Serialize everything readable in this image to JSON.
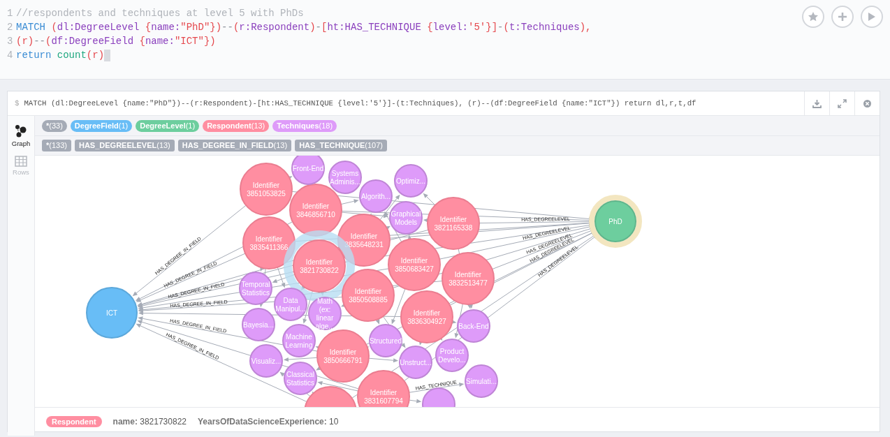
{
  "editor": {
    "lines": [
      {
        "number": "1",
        "tokens": [
          {
            "kind": "comment",
            "text": "//respondents and techniques at level 5 with PhDs"
          }
        ]
      },
      {
        "number": "2",
        "tokens": [
          {
            "kind": "keyword",
            "text": "MATCH "
          },
          {
            "kind": "punct",
            "text": "("
          },
          {
            "kind": "ident",
            "text": "dl:DegreeLevel "
          },
          {
            "kind": "punct",
            "text": "{"
          },
          {
            "kind": "ident",
            "text": "name:"
          },
          {
            "kind": "string",
            "text": "\"PhD\""
          },
          {
            "kind": "punct",
            "text": "})"
          },
          {
            "kind": "op",
            "text": "--"
          },
          {
            "kind": "punct",
            "text": "("
          },
          {
            "kind": "ident",
            "text": "r:Respondent"
          },
          {
            "kind": "punct",
            "text": ")"
          },
          {
            "kind": "op",
            "text": "-"
          },
          {
            "kind": "punct",
            "text": "["
          },
          {
            "kind": "ident",
            "text": "ht:HAS_TECHNIQUE "
          },
          {
            "kind": "punct",
            "text": "{"
          },
          {
            "kind": "ident",
            "text": "level:"
          },
          {
            "kind": "string",
            "text": "'5'"
          },
          {
            "kind": "punct",
            "text": "}]"
          },
          {
            "kind": "op",
            "text": "-"
          },
          {
            "kind": "punct",
            "text": "("
          },
          {
            "kind": "ident",
            "text": "t:Techniques"
          },
          {
            "kind": "punct",
            "text": "),"
          }
        ]
      },
      {
        "number": "3",
        "tokens": [
          {
            "kind": "punct",
            "text": "(r)"
          },
          {
            "kind": "op",
            "text": "--"
          },
          {
            "kind": "punct",
            "text": "("
          },
          {
            "kind": "ident",
            "text": "df:DegreeField "
          },
          {
            "kind": "punct",
            "text": "{"
          },
          {
            "kind": "ident",
            "text": "name:"
          },
          {
            "kind": "string",
            "text": "\"ICT\""
          },
          {
            "kind": "punct",
            "text": "})"
          }
        ]
      },
      {
        "number": "4",
        "tokens": [
          {
            "kind": "keyword",
            "text": "return "
          },
          {
            "kind": "func",
            "text": "count"
          },
          {
            "kind": "punct",
            "text": "(r)"
          }
        ]
      }
    ]
  },
  "frame": {
    "prompt": "$",
    "query": "MATCH (dl:DegreeLevel {name:\"PhD\"})--(r:Respondent)-[ht:HAS_TECHNIQUE {level:'5'}]-(t:Techniques), (r)--(df:DegreeField {name:\"ICT\"}) return dl,r,t,df"
  },
  "sidebar": [
    {
      "label": "Graph",
      "kind": "graph",
      "selected": true
    },
    {
      "label": "Rows",
      "kind": "rows",
      "selected": false
    }
  ],
  "node_labels": [
    {
      "name": "*",
      "count": "(33)",
      "color": "#a5abb6"
    },
    {
      "name": "DegreeField",
      "count": "(1)",
      "color": "#68bdf6"
    },
    {
      "name": "DegreeLevel",
      "count": "(1)",
      "color": "#6dce9e"
    },
    {
      "name": "Respondent",
      "count": "(13)",
      "color": "#ff8ea1"
    },
    {
      "name": "Techniques",
      "count": "(18)",
      "color": "#de9bf9"
    }
  ],
  "relationship_types": [
    {
      "name": "*",
      "count": "(133)"
    },
    {
      "name": "HAS_DEGREELEVEL",
      "count": "(13)"
    },
    {
      "name": "HAS_DEGREE_IN_FIELD",
      "count": "(13)"
    },
    {
      "name": "HAS_TECHNIQUE",
      "count": "(107)"
    }
  ],
  "graph": {
    "nodes": [
      {
        "kind": "field",
        "lines": [
          "ICT"
        ],
        "selected": false,
        "hovered": false
      },
      {
        "kind": "level",
        "lines": [
          "PhD"
        ],
        "selected": false,
        "hovered": true
      },
      {
        "kind": "respondent",
        "lines": [
          "Identifier",
          "3851053825"
        ],
        "selected": false,
        "hovered": false
      },
      {
        "kind": "respondent",
        "lines": [
          "Identifier",
          "3846856710"
        ],
        "selected": false,
        "hovered": false
      },
      {
        "kind": "respondent",
        "lines": [
          "Identifier",
          "3835411366"
        ],
        "selected": false,
        "hovered": false
      },
      {
        "kind": "respondent",
        "lines": [
          "Identifier",
          "3835648231"
        ],
        "selected": false,
        "hovered": false
      },
      {
        "kind": "respondent",
        "lines": [
          "Identifier",
          "3821730822"
        ],
        "selected": true,
        "hovered": false
      },
      {
        "kind": "respondent",
        "lines": [
          "Identifier",
          "3821165338"
        ],
        "selected": false,
        "hovered": false
      },
      {
        "kind": "respondent",
        "lines": [
          "Identifier",
          "3850683427"
        ],
        "selected": false,
        "hovered": false
      },
      {
        "kind": "respondent",
        "lines": [
          "Identifier",
          "3832513477"
        ],
        "selected": false,
        "hovered": false
      },
      {
        "kind": "respondent",
        "lines": [
          "Identifier",
          "3850508885"
        ],
        "selected": false,
        "hovered": false
      },
      {
        "kind": "respondent",
        "lines": [
          "Identifier",
          "3836304927"
        ],
        "selected": false,
        "hovered": false
      },
      {
        "kind": "respondent",
        "lines": [
          "Identifier",
          "3850666791"
        ],
        "selected": false,
        "hovered": false
      },
      {
        "kind": "respondent",
        "lines": [
          "Identifier",
          "3831607794"
        ],
        "selected": false,
        "hovered": false
      },
      {
        "kind": "respondent",
        "selected": false,
        "hovered": false
      },
      {
        "kind": "technique",
        "lines": [
          "Front-End"
        ],
        "selected": false,
        "hovered": false
      },
      {
        "kind": "technique",
        "lines": [
          "Systems",
          "Adminis..."
        ],
        "selected": false,
        "hovered": false
      },
      {
        "kind": "technique",
        "lines": [
          "Algorith..."
        ],
        "selected": false,
        "hovered": false
      },
      {
        "kind": "technique",
        "lines": [
          "Optimiz..."
        ],
        "selected": false,
        "hovered": false
      },
      {
        "kind": "technique",
        "lines": [
          "Graphical",
          "Models"
        ],
        "selected": false,
        "hovered": false
      },
      {
        "kind": "technique",
        "lines": [
          "Temporal",
          "Statistics"
        ],
        "selected": false,
        "hovered": false
      },
      {
        "kind": "technique",
        "lines": [
          "Data",
          "Manipul..."
        ],
        "selected": false,
        "hovered": false
      },
      {
        "kind": "technique",
        "lines": [
          "Bayesia..."
        ],
        "selected": false,
        "hovered": false
      },
      {
        "kind": "technique",
        "lines": [
          "Math",
          "(ex:",
          "linear",
          "alge..."
        ],
        "selected": false,
        "hovered": false
      },
      {
        "kind": "technique",
        "lines": [
          "Machine",
          "Learning"
        ],
        "selected": false,
        "hovered": false
      },
      {
        "kind": "technique",
        "lines": [
          "Visualiz..."
        ],
        "selected": false,
        "hovered": false
      },
      {
        "kind": "technique",
        "lines": [
          "Classical",
          "Statistics"
        ],
        "selected": false,
        "hovered": false
      },
      {
        "kind": "technique",
        "lines": [
          "Structured"
        ],
        "selected": false,
        "hovered": false
      },
      {
        "kind": "technique",
        "lines": [
          "Unstruct..."
        ],
        "selected": false,
        "hovered": false
      },
      {
        "kind": "technique",
        "lines": [
          "Back-End"
        ],
        "selected": false,
        "hovered": false
      },
      {
        "kind": "technique",
        "lines": [
          "Product",
          "Develo..."
        ],
        "selected": false,
        "hovered": false
      },
      {
        "kind": "technique",
        "lines": [
          "Simulati..."
        ],
        "selected": false,
        "hovered": false
      },
      {
        "kind": "technique",
        "selected": false,
        "hovered": false
      }
    ],
    "edge_labels": [
      "HAS_DEGREE_IN_FIELD",
      "HAS_DEGREE_IN_FIELD",
      "HAS_DEGREE_IN_FIELD",
      "HAS_DEGREE_IN_FIELD",
      "HAS_DEGREE_IN_FIELD",
      "HAS_DEGREE_IN_FIELD",
      "HAS_DEGREELEVEL",
      "HAS_DEGREELEVEL",
      "HAS_DEGREELEVEL",
      "HAS_DEGREELEVEL",
      "HAS_DEGREELEVEL",
      "HAS_TECHNIQUE"
    ]
  },
  "details": {
    "label": "Respondent",
    "properties": [
      {
        "key": "name:",
        "value": "3821730822"
      },
      {
        "key": "YearsOfDataScienceExperience:",
        "value": "10"
      }
    ]
  }
}
